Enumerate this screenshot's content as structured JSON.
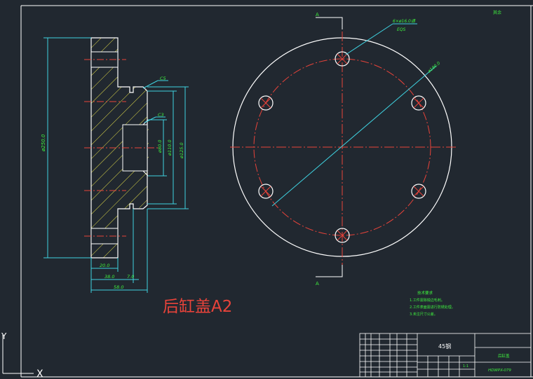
{
  "section": {
    "top_label": "A",
    "bottom_label": "A"
  },
  "top_right_note": "其余",
  "dimensions": {
    "dia_outer": "ø250.0",
    "dia_a": "ø125.0",
    "dia_b": "ø110.0",
    "dia_c": "ø80.0",
    "chamfer1": "C5",
    "chamfer2": "C3",
    "len_20": "20.0",
    "len_38": "38.0",
    "len_58": "58.0",
    "len_7": "7.0"
  },
  "front_view": {
    "holes_note": "6×ø16.0通",
    "holes_sub": "EQS",
    "pcd": "ø180.0"
  },
  "tech_notes": {
    "title": "技术要求",
    "items": [
      "1.工件需除锐边毛刺。",
      "2.工件表面需进行防锈处理。",
      "3.未注尺寸公差。"
    ]
  },
  "caption": "后缸盖A2",
  "title_block": {
    "material": "45钢",
    "part_name": "后缸盖",
    "drawing_no": "HDWPX-079",
    "scale": "1:1"
  },
  "ucs": {
    "x": "X",
    "y": "Y"
  }
}
